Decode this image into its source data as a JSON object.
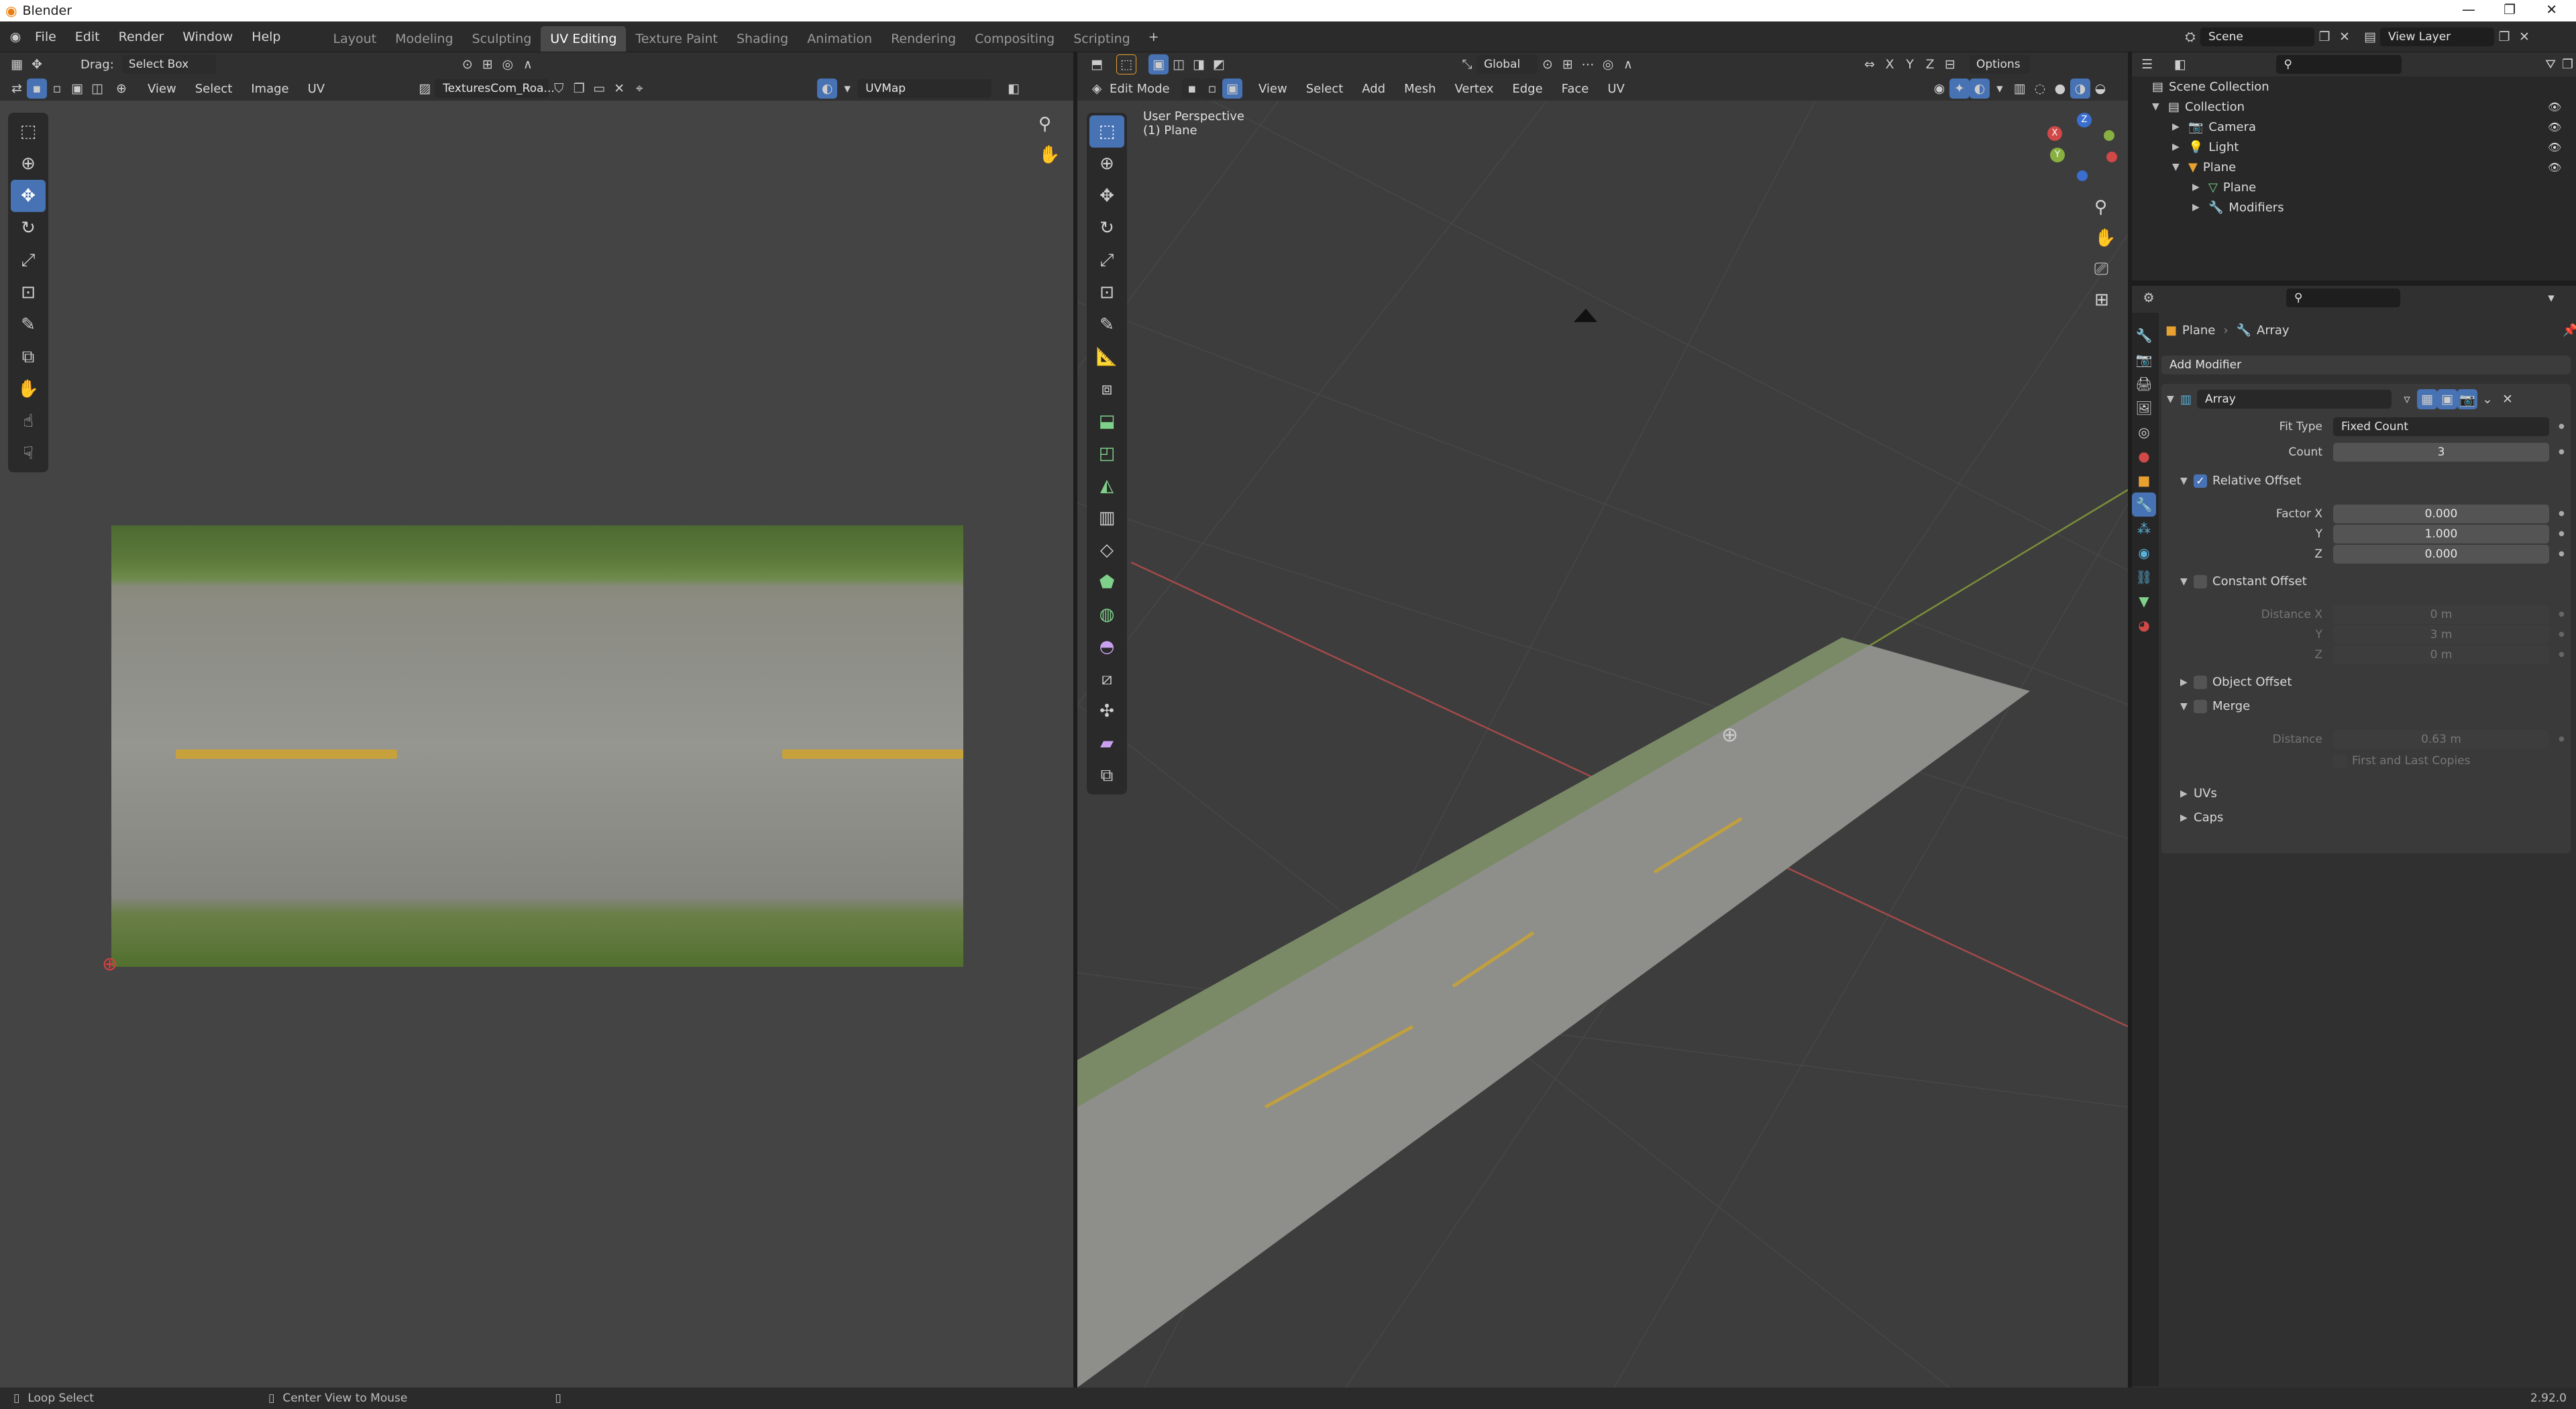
{
  "window": {
    "title": "Blender"
  },
  "menus": [
    "File",
    "Edit",
    "Render",
    "Window",
    "Help"
  ],
  "workspaces": [
    "Layout",
    "Modeling",
    "Sculpting",
    "UV Editing",
    "Texture Paint",
    "Shading",
    "Animation",
    "Rendering",
    "Compositing",
    "Scripting"
  ],
  "active_workspace": "UV Editing",
  "scene": {
    "name": "Scene",
    "view_layer": "View Layer"
  },
  "uv_editor": {
    "drag_label": "Drag:",
    "drag_value": "Select Box",
    "menus": [
      "View",
      "Select",
      "Image",
      "UV"
    ],
    "image_name": "TexturesCom_Roa...",
    "uvmap": "UVMap"
  },
  "viewport": {
    "mode": "Edit Mode",
    "menus": [
      "View",
      "Select",
      "Add",
      "Mesh",
      "Vertex",
      "Edge",
      "Face",
      "UV"
    ],
    "orientation": "Global",
    "options": "Options",
    "perspective": "User Perspective",
    "object": "(1) Plane",
    "gizmo": {
      "x": "X",
      "y": "Y",
      "z": "Z"
    },
    "colors": {
      "x_axis": "#d04848",
      "y_axis": "#88b040"
    }
  },
  "outliner": {
    "root": "Scene Collection",
    "items": [
      {
        "label": "Collection",
        "depth": 0
      },
      {
        "label": "Camera",
        "depth": 1
      },
      {
        "label": "Light",
        "depth": 1
      },
      {
        "label": "Plane",
        "depth": 1
      },
      {
        "label": "Plane",
        "depth": 2
      },
      {
        "label": "Modifiers",
        "depth": 2
      }
    ]
  },
  "properties": {
    "breadcrumb": [
      "Plane",
      "Array"
    ],
    "add_modifier": "Add Modifier",
    "modifier_name": "Array",
    "fit_type_label": "Fit Type",
    "fit_type": "Fixed Count",
    "count_label": "Count",
    "count": "3",
    "relative_offset": "Relative Offset",
    "factor": [
      {
        "label": "Factor X",
        "value": "0.000"
      },
      {
        "label": "Y",
        "value": "1.000"
      },
      {
        "label": "Z",
        "value": "0.000"
      }
    ],
    "constant_offset": "Constant Offset",
    "distance": [
      {
        "label": "Distance X",
        "value": "0 m"
      },
      {
        "label": "Y",
        "value": "3 m"
      },
      {
        "label": "Z",
        "value": "0 m"
      }
    ],
    "object_offset": "Object Offset",
    "merge": "Merge",
    "merge_distance_label": "Distance",
    "merge_distance": "0.63 m",
    "first_last": "First and Last Copies",
    "uvs": "UVs",
    "caps": "Caps"
  },
  "status": {
    "left": "Loop Select",
    "middle": "Center View to Mouse",
    "version": "2.92.0"
  },
  "accent": "#4772b3"
}
